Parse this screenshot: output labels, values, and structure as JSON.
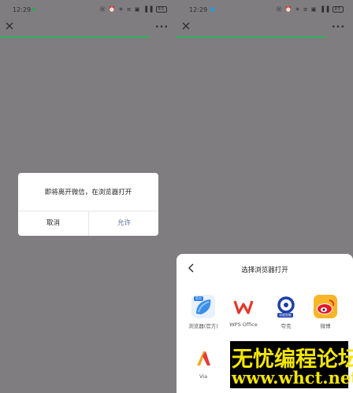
{
  "status_bar": {
    "time": "12:29",
    "icons_text": "Ⓝ ⏰ ✳ ≡ ▣ ▐▐",
    "battery": "85"
  },
  "left_screen": {
    "dialog": {
      "message": "即将离开微信，在浏览器打开",
      "cancel_label": "取消",
      "allow_label": "允许"
    }
  },
  "right_screen": {
    "sheet": {
      "title": "选择浏览器打开",
      "apps": [
        {
          "label": "浏览器(官方)",
          "badge": "官方"
        },
        {
          "label": "WPS Office"
        },
        {
          "label": "夸克",
          "badge": "深度智能"
        },
        {
          "label": "微博"
        },
        {
          "label": "Via"
        }
      ]
    }
  },
  "watermark": {
    "line1": "无忧编程论坛",
    "line2": "www.whct.net"
  },
  "colors": {
    "overlay": "#7f7d80",
    "wechat_green": "#33b05d",
    "link_blue": "#576b95",
    "watermark_yellow": "#f2e600"
  }
}
